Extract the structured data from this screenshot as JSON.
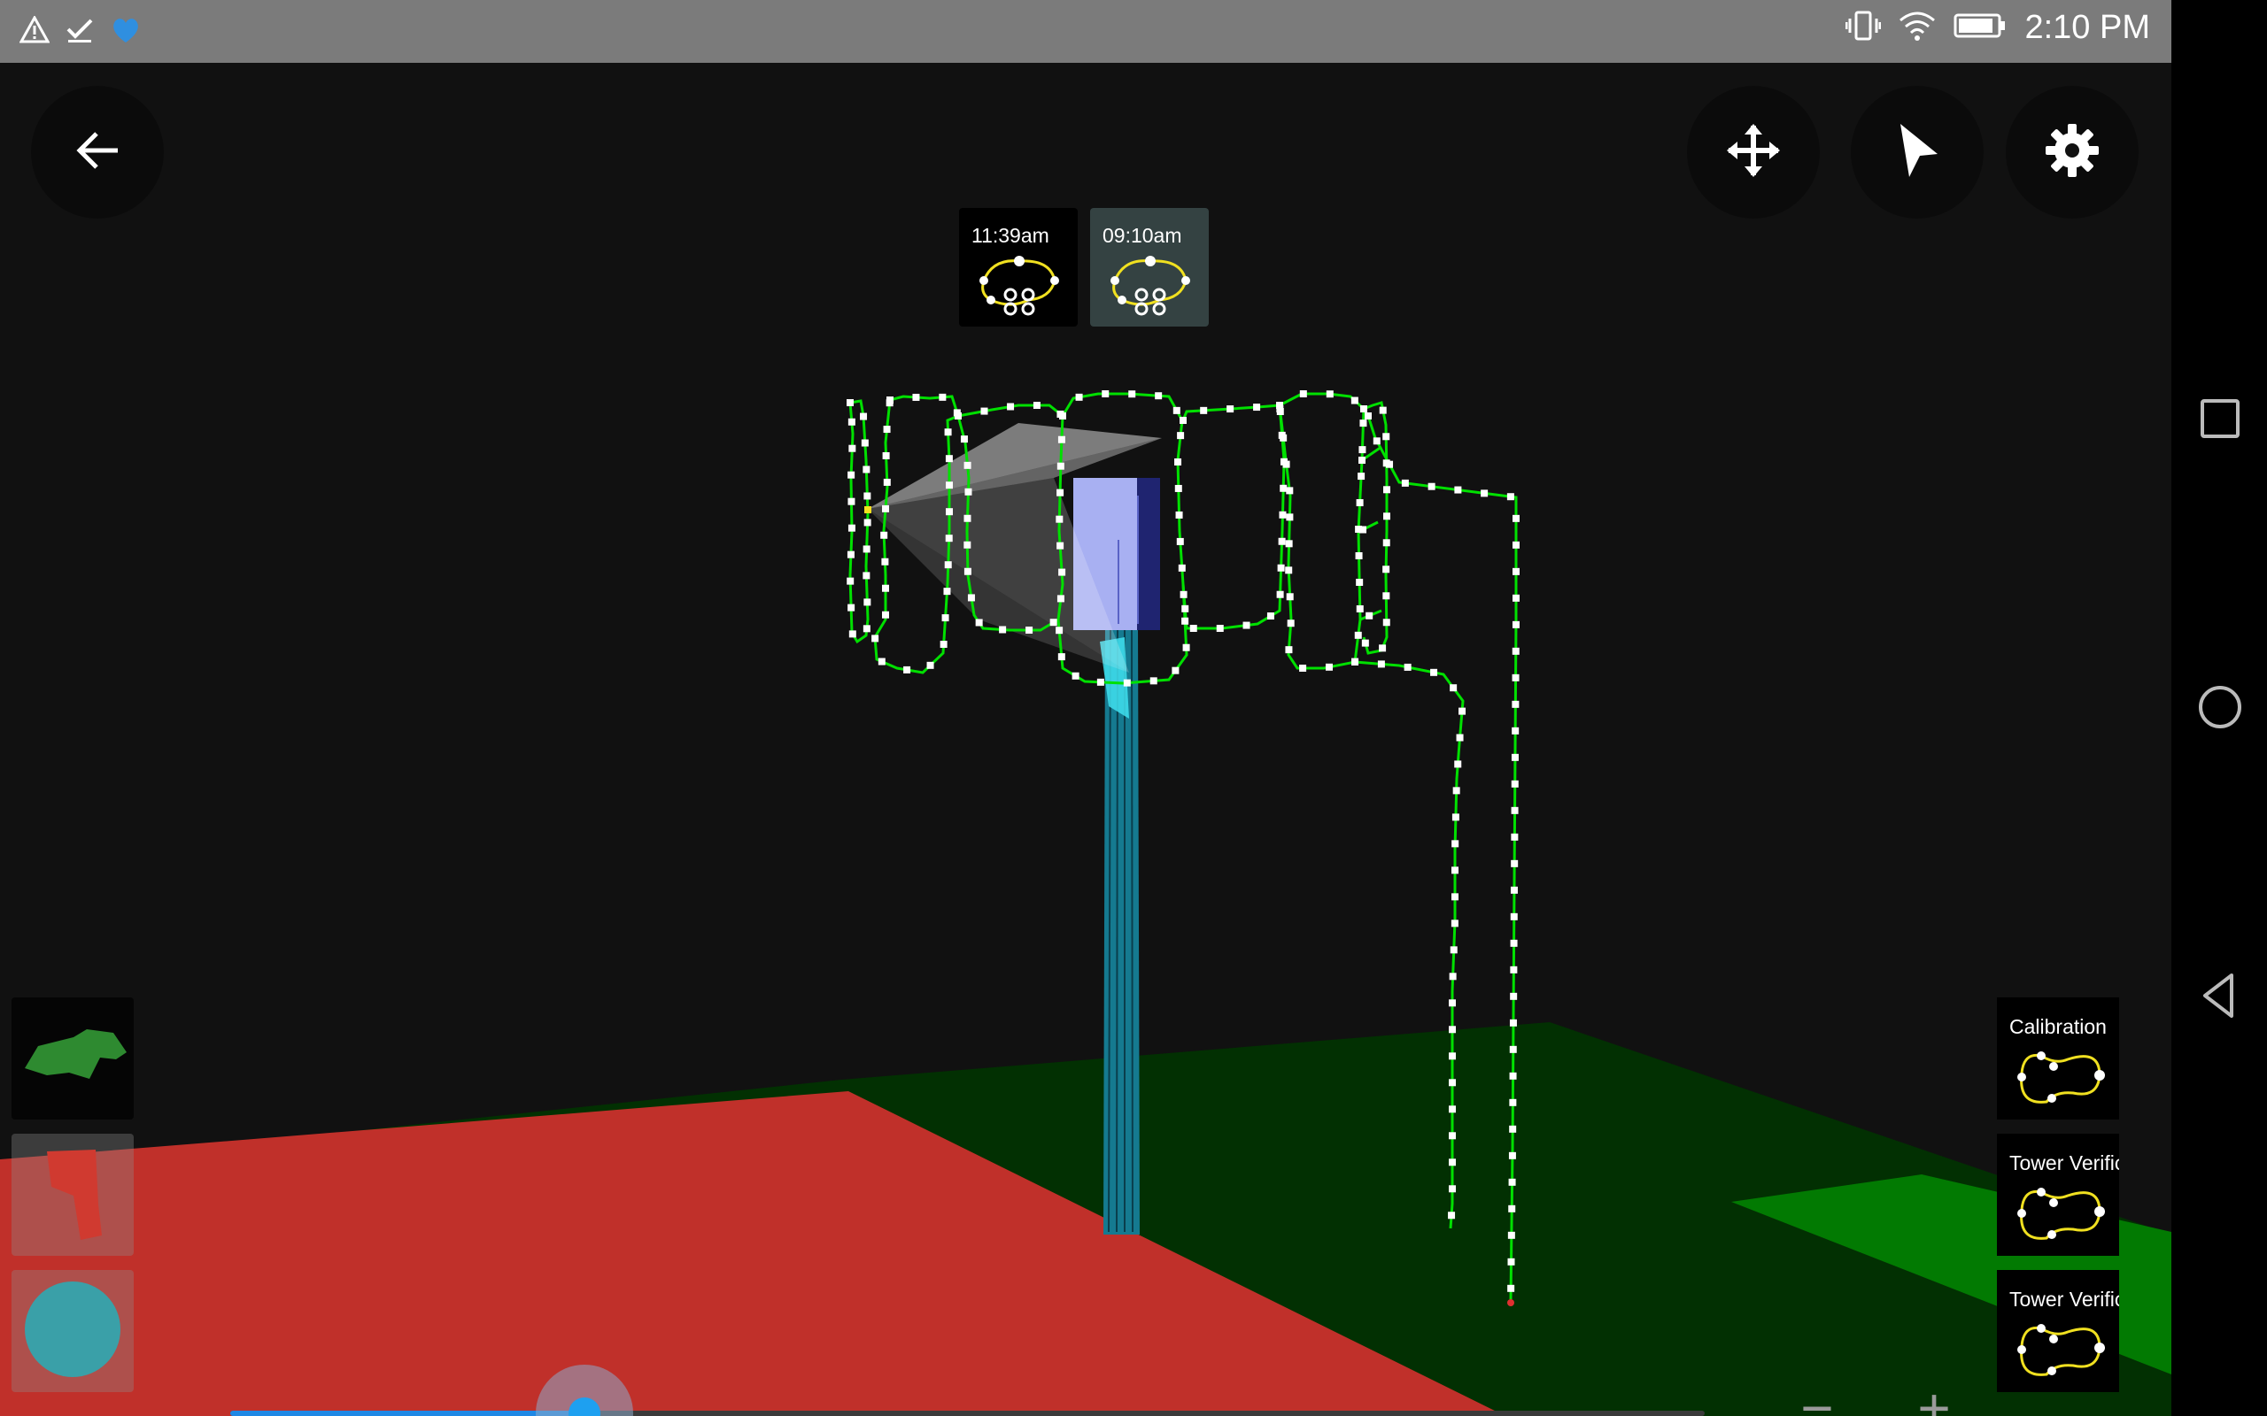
{
  "status_bar": {
    "time": "2:10 PM",
    "left_icons": [
      "warning-icon",
      "check-icon",
      "heart-icon"
    ],
    "right_icons": [
      "vibrate-icon",
      "wifi-icon",
      "battery-icon"
    ]
  },
  "toolbar": {
    "back_icon": "arrow-back-icon",
    "right_buttons": [
      "move-icon",
      "pointer-icon",
      "settings-icon"
    ]
  },
  "flights": [
    {
      "time": "11:39am",
      "icon": "flight-path-icon",
      "selected": false
    },
    {
      "time": "09:10am",
      "icon": "flight-path-icon",
      "selected": true
    }
  ],
  "missions": [
    {
      "label": "Calibration",
      "icon": "mission-path-icon"
    },
    {
      "label": "Tower Verification",
      "icon": "mission-path-icon"
    },
    {
      "label": "Tower Verification",
      "icon": "mission-path-icon"
    }
  ],
  "layers": [
    {
      "icon": "green-terrain-icon"
    },
    {
      "icon": "red-zone-icon"
    },
    {
      "icon": "circle-zone-icon"
    }
  ],
  "timeline": {
    "position": 0.24
  },
  "zoom": {
    "out_label": "−",
    "in_label": "+"
  },
  "colors": {
    "status_bar": "#7b7b7b",
    "background": "#111111",
    "ground_dark": "#023002",
    "ground_bright": "#027a02",
    "red_zone": "#c0302a",
    "flight_path": "#00e000",
    "tower": "#1a8fa8",
    "accent": "#1e88e5"
  }
}
